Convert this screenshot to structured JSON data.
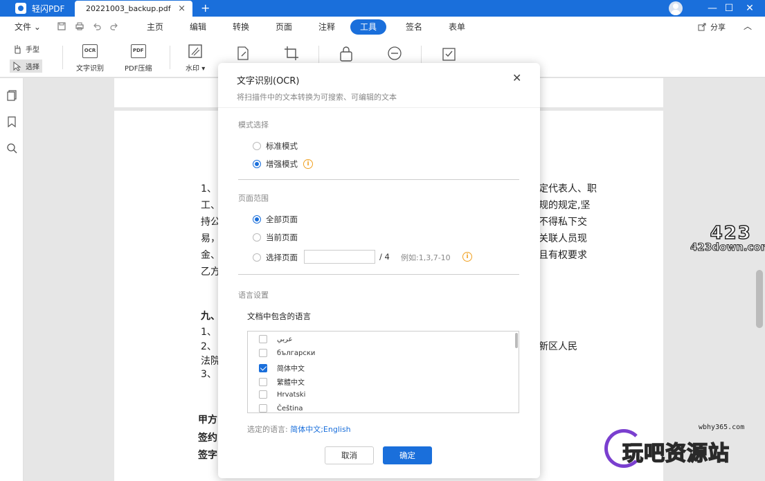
{
  "app": {
    "name": "轻闪PDF"
  },
  "tabs": {
    "document": "20221003_backup.pdf",
    "close_glyph": "×",
    "new_glyph": "+"
  },
  "window": {
    "minimize": "—",
    "maximize": "☐",
    "close": "✕"
  },
  "menu": {
    "file": "文件",
    "tabs": [
      "主页",
      "编辑",
      "转换",
      "页面",
      "注释",
      "工具",
      "签名",
      "表单"
    ],
    "active": "工具",
    "share": "分享"
  },
  "toolbar": {
    "hand": "手型",
    "select": "选择",
    "ocr": "文字识别",
    "ocr_icon_text": "OCR",
    "compress": "PDF压缩",
    "compress_icon_text": "PDF",
    "watermark": "水印"
  },
  "document": {
    "lines": [
      {
        "left": "1、",
        "right": "定代表人、职"
      },
      {
        "left": "工、",
        "right": "规的规定,坚"
      },
      {
        "left": "持公",
        "right": "不得私下交"
      },
      {
        "left": "易，",
        "right": "关联人员现"
      },
      {
        "left": "金、",
        "right": "且有权要求"
      },
      {
        "left": "乙方",
        "right": ""
      },
      {
        "left": "九、",
        "right": ""
      },
      {
        "left": "1、",
        "right": ""
      },
      {
        "left": "2、",
        "right": "新区人民"
      },
      {
        "left": "法院",
        "right": ""
      },
      {
        "left": "3、",
        "right": ""
      },
      {
        "left": "甲方",
        "right": ""
      },
      {
        "left": "签约",
        "right": ""
      },
      {
        "left": "签字",
        "right": ""
      }
    ]
  },
  "watermarks": {
    "site423_big": "423",
    "site423_small": "423down.com",
    "wb_url": "wbhy365.com",
    "wb_text": "玩吧资源站"
  },
  "dialog": {
    "title": "文字识别(OCR)",
    "subtitle": "将扫描件中的文本转换为可搜索、可编辑的文本",
    "mode_section": "模式选择",
    "modes": [
      {
        "label": "标准模式",
        "checked": false
      },
      {
        "label": "增强模式",
        "checked": true
      }
    ],
    "range_section": "页面范围",
    "ranges": [
      {
        "label": "全部页面",
        "checked": true
      },
      {
        "label": "当前页面",
        "checked": false
      },
      {
        "label": "选择页面",
        "checked": false
      }
    ],
    "page_input_value": "",
    "page_total": "/ 4",
    "page_example": "例如:1,3,7-10",
    "lang_section": "语言设置",
    "lang_label": "文档中包含的语言",
    "languages": [
      {
        "label": "عربي",
        "checked": false
      },
      {
        "label": "български",
        "checked": false
      },
      {
        "label": "简体中文",
        "checked": true
      },
      {
        "label": "繁體中文",
        "checked": false
      },
      {
        "label": "Hrvatski",
        "checked": false
      },
      {
        "label": "Čeština",
        "checked": false
      }
    ],
    "selected_prefix": "选定的语言:",
    "selected_value": "简体中文;English",
    "cancel": "取消",
    "ok": "确定",
    "close_glyph": "✕",
    "info_glyph": "i"
  },
  "colors": {
    "accent": "#1a6fdb",
    "warning": "#f0a020"
  }
}
